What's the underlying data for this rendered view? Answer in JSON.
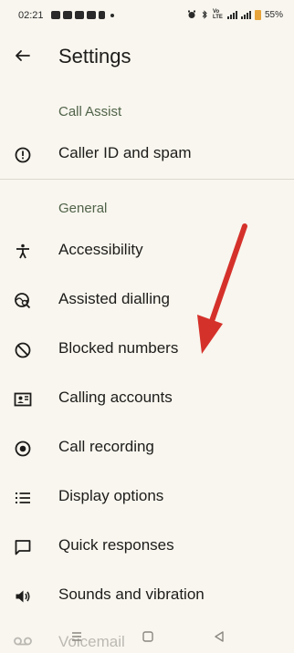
{
  "status_bar": {
    "time": "02:21",
    "volte": "Vo LTE",
    "battery": "55%",
    "battery_color": "#e7a43a"
  },
  "app_bar": {
    "title": "Settings",
    "back_icon": "arrow-back-icon"
  },
  "sections": [
    {
      "header": "Call Assist",
      "items": [
        {
          "label": "Caller ID and spam",
          "icon": "info-circle-icon"
        }
      ]
    },
    {
      "header": "General",
      "items": [
        {
          "label": "Accessibility",
          "icon": "accessibility-icon"
        },
        {
          "label": "Assisted dialling",
          "icon": "assisted-dialling-icon"
        },
        {
          "label": "Blocked numbers",
          "icon": "block-icon"
        },
        {
          "label": "Calling accounts",
          "icon": "account-card-icon"
        },
        {
          "label": "Call recording",
          "icon": "record-icon"
        },
        {
          "label": "Display options",
          "icon": "list-icon"
        },
        {
          "label": "Quick responses",
          "icon": "message-icon"
        },
        {
          "label": "Sounds and vibration",
          "icon": "speaker-icon"
        },
        {
          "label": "Voicemail",
          "icon": "voicemail-icon"
        }
      ]
    }
  ],
  "annotation": {
    "arrow_color": "#d5312b",
    "points_to": "Blocked numbers"
  },
  "colors": {
    "background": "#f8f6ee",
    "section_header": "#51634a",
    "text": "#1d1c1a"
  }
}
